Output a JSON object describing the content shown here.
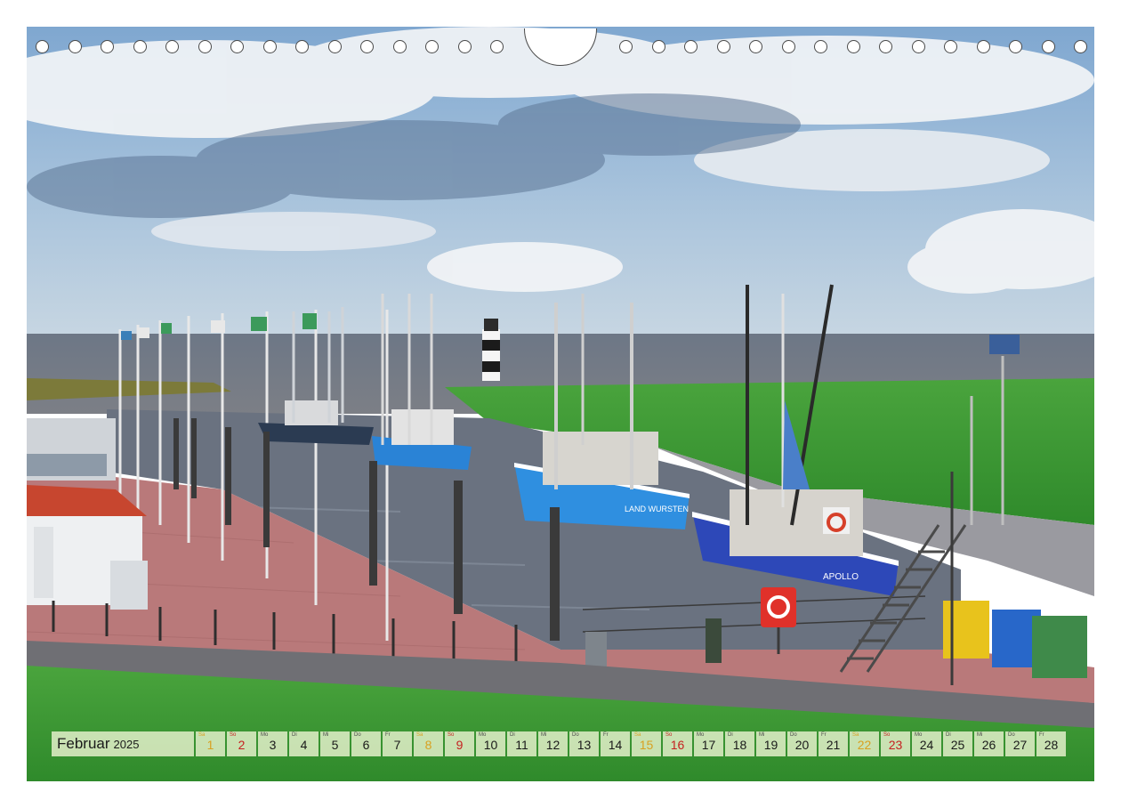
{
  "calendar": {
    "month": "Februar",
    "year": "2025",
    "days": [
      {
        "wd": "Sa",
        "num": "1",
        "type": "sat"
      },
      {
        "wd": "So",
        "num": "2",
        "type": "sun"
      },
      {
        "wd": "Mo",
        "num": "3",
        "type": "work"
      },
      {
        "wd": "Di",
        "num": "4",
        "type": "work"
      },
      {
        "wd": "Mi",
        "num": "5",
        "type": "work"
      },
      {
        "wd": "Do",
        "num": "6",
        "type": "work"
      },
      {
        "wd": "Fr",
        "num": "7",
        "type": "work"
      },
      {
        "wd": "Sa",
        "num": "8",
        "type": "sat"
      },
      {
        "wd": "So",
        "num": "9",
        "type": "sun"
      },
      {
        "wd": "Mo",
        "num": "10",
        "type": "work"
      },
      {
        "wd": "Di",
        "num": "11",
        "type": "work"
      },
      {
        "wd": "Mi",
        "num": "12",
        "type": "work"
      },
      {
        "wd": "Do",
        "num": "13",
        "type": "work"
      },
      {
        "wd": "Fr",
        "num": "14",
        "type": "work"
      },
      {
        "wd": "Sa",
        "num": "15",
        "type": "sat"
      },
      {
        "wd": "So",
        "num": "16",
        "type": "sun"
      },
      {
        "wd": "Mo",
        "num": "17",
        "type": "work"
      },
      {
        "wd": "Di",
        "num": "18",
        "type": "work"
      },
      {
        "wd": "Mi",
        "num": "19",
        "type": "work"
      },
      {
        "wd": "Do",
        "num": "20",
        "type": "work"
      },
      {
        "wd": "Fr",
        "num": "21",
        "type": "work"
      },
      {
        "wd": "Sa",
        "num": "22",
        "type": "sat"
      },
      {
        "wd": "So",
        "num": "23",
        "type": "sun"
      },
      {
        "wd": "Mo",
        "num": "24",
        "type": "work"
      },
      {
        "wd": "Di",
        "num": "25",
        "type": "work"
      },
      {
        "wd": "Mi",
        "num": "26",
        "type": "work"
      },
      {
        "wd": "Do",
        "num": "27",
        "type": "work"
      },
      {
        "wd": "Fr",
        "num": "28",
        "type": "work"
      }
    ]
  },
  "photo": {
    "boats": [
      {
        "name": "LAND WURSTEN"
      },
      {
        "name": "APOLLO"
      }
    ]
  },
  "colors": {
    "saturday": "#d9a020",
    "sunday": "#c62020",
    "cell_bg": "#d6e8be",
    "sky": "#8fb2d4",
    "grass": "#3f9a35",
    "water": "#6d7a88",
    "boat_blue": "#1f73c6"
  }
}
